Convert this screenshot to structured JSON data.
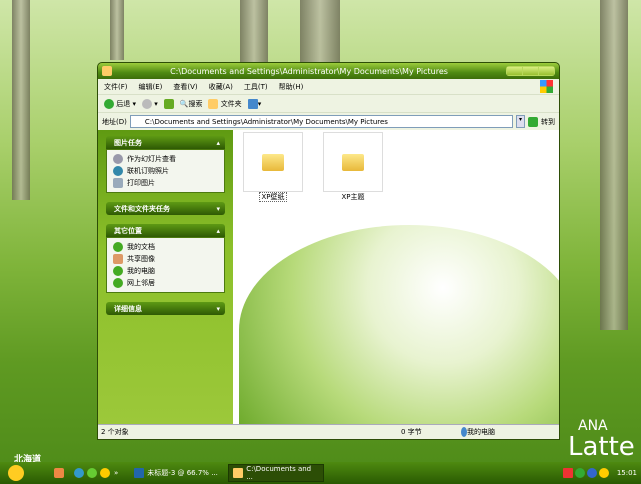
{
  "window": {
    "title": "C:\\Documents and Settings\\Administrator\\My Documents\\My Pictures"
  },
  "menu": [
    "文件(F)",
    "编辑(E)",
    "查看(V)",
    "收藏(A)",
    "工具(T)",
    "帮助(H)"
  ],
  "toolbar": {
    "back": "后退",
    "search": "搜索",
    "folders": "文件夹"
  },
  "address": {
    "label": "地址(D)",
    "value": "C:\\Documents and Settings\\Administrator\\My Documents\\My Pictures",
    "go": "转到"
  },
  "panels": {
    "picture_tasks": {
      "title": "图片任务",
      "items": [
        "作为幻灯片查看",
        "联机订购照片",
        "打印图片"
      ]
    },
    "file_tasks": {
      "title": "文件和文件夹任务"
    },
    "other_places": {
      "title": "其它位置",
      "items": [
        "我的文档",
        "共享图像",
        "我的电脑",
        "网上邻居"
      ]
    },
    "details": {
      "title": "详细信息"
    }
  },
  "files": [
    "XP壁纸",
    "XP主题"
  ],
  "status": {
    "objects": "2 个对象",
    "size": "0 字节",
    "location": "我的电脑"
  },
  "wallpaper": {
    "left_text": "北海道",
    "brand1": "ANA",
    "brand2": "Latte"
  },
  "taskbar": {
    "tasks": [
      "未标题-3 @ 66.7% ...",
      "C:\\Documents and ..."
    ],
    "chevron": "»",
    "clock": "15:01"
  }
}
